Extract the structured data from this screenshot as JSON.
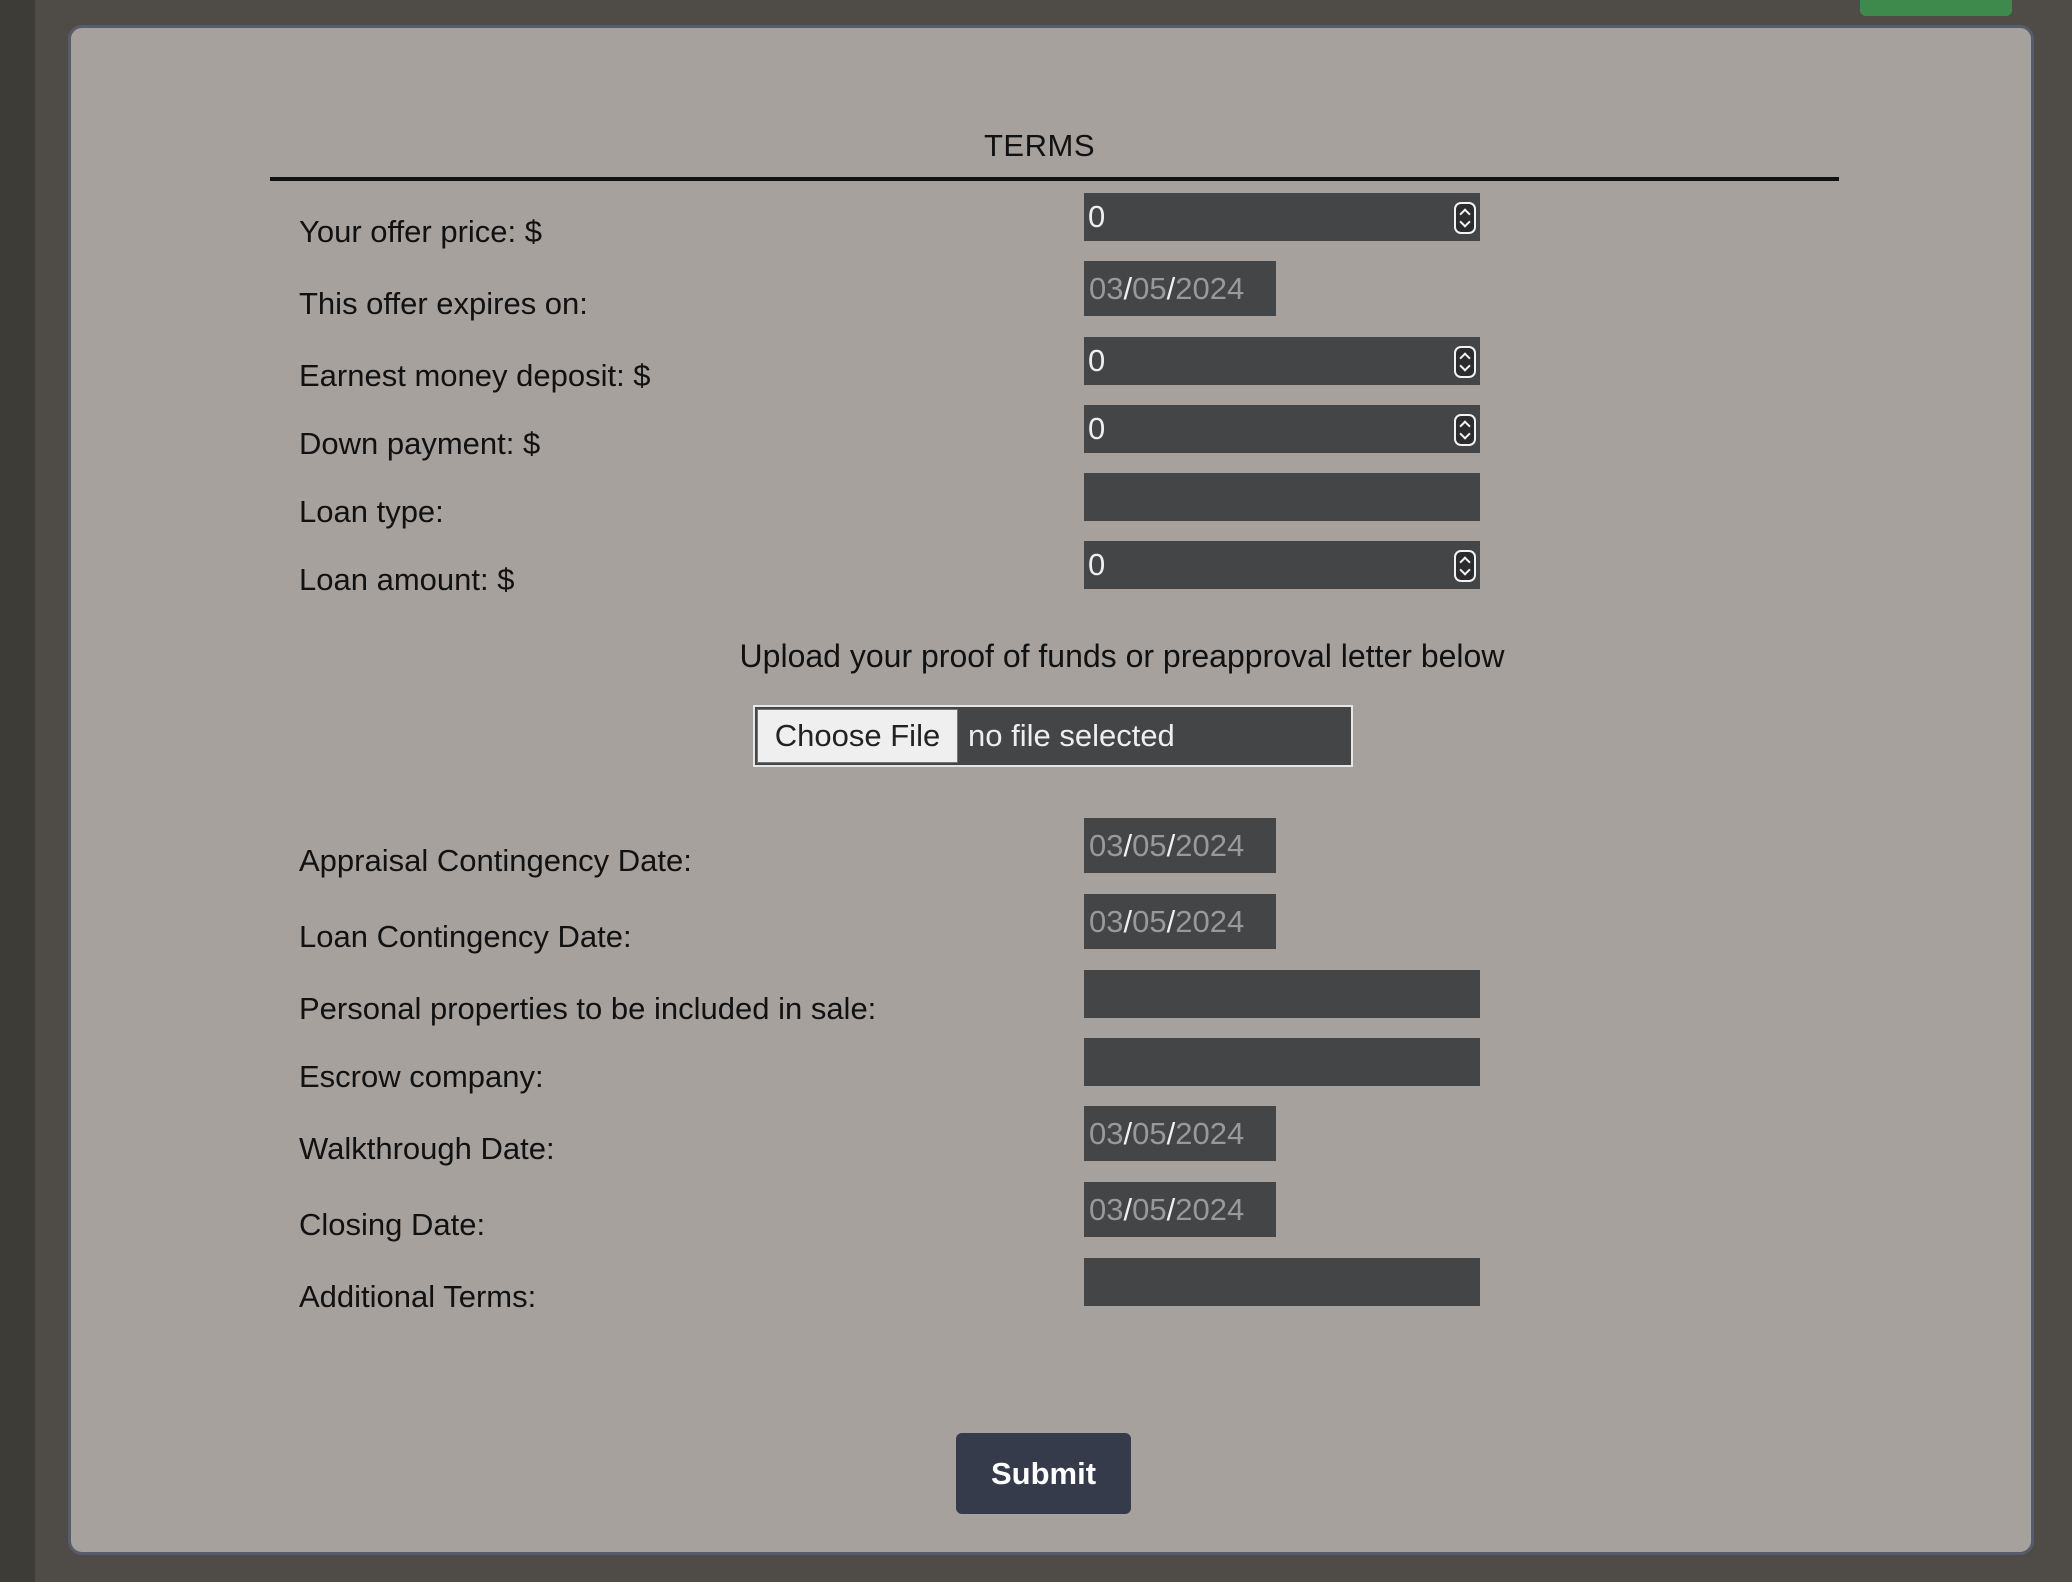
{
  "form": {
    "title": "TERMS",
    "fields": {
      "offer_price": {
        "label": "Your offer price: $",
        "value": "0"
      },
      "expires_on": {
        "label": "This offer expires on:",
        "month": "03",
        "day": "05",
        "year": "2024"
      },
      "earnest_money": {
        "label": "Earnest money deposit: $",
        "value": "0"
      },
      "down_payment": {
        "label": "Down payment: $",
        "value": "0"
      },
      "loan_type": {
        "label": "Loan type:",
        "value": ""
      },
      "loan_amount": {
        "label": "Loan amount: $",
        "value": "0"
      },
      "appraisal_date": {
        "label": "Appraisal Contingency Date:",
        "month": "03",
        "day": "05",
        "year": "2024"
      },
      "loan_contingency_date": {
        "label": "Loan Contingency Date:",
        "month": "03",
        "day": "05",
        "year": "2024"
      },
      "personal_properties": {
        "label": "Personal properties to be included in sale:",
        "value": ""
      },
      "escrow_company": {
        "label": "Escrow company:",
        "value": ""
      },
      "walkthrough_date": {
        "label": "Walkthrough Date:",
        "month": "03",
        "day": "05",
        "year": "2024"
      },
      "closing_date": {
        "label": "Closing Date:",
        "month": "03",
        "day": "05",
        "year": "2024"
      },
      "additional_terms": {
        "label": "Additional Terms:",
        "value": ""
      }
    },
    "upload": {
      "instruction": "Upload your proof of funds or preapproval letter below",
      "button_label": "Choose File",
      "status": "no file selected"
    },
    "submit_label": "Submit",
    "date_separator": "/"
  },
  "colors": {
    "modal_bg": "#a7a19e",
    "field_bg": "#444547",
    "submit_bg": "#353b4b",
    "accent_green": "#3d8a4c"
  }
}
